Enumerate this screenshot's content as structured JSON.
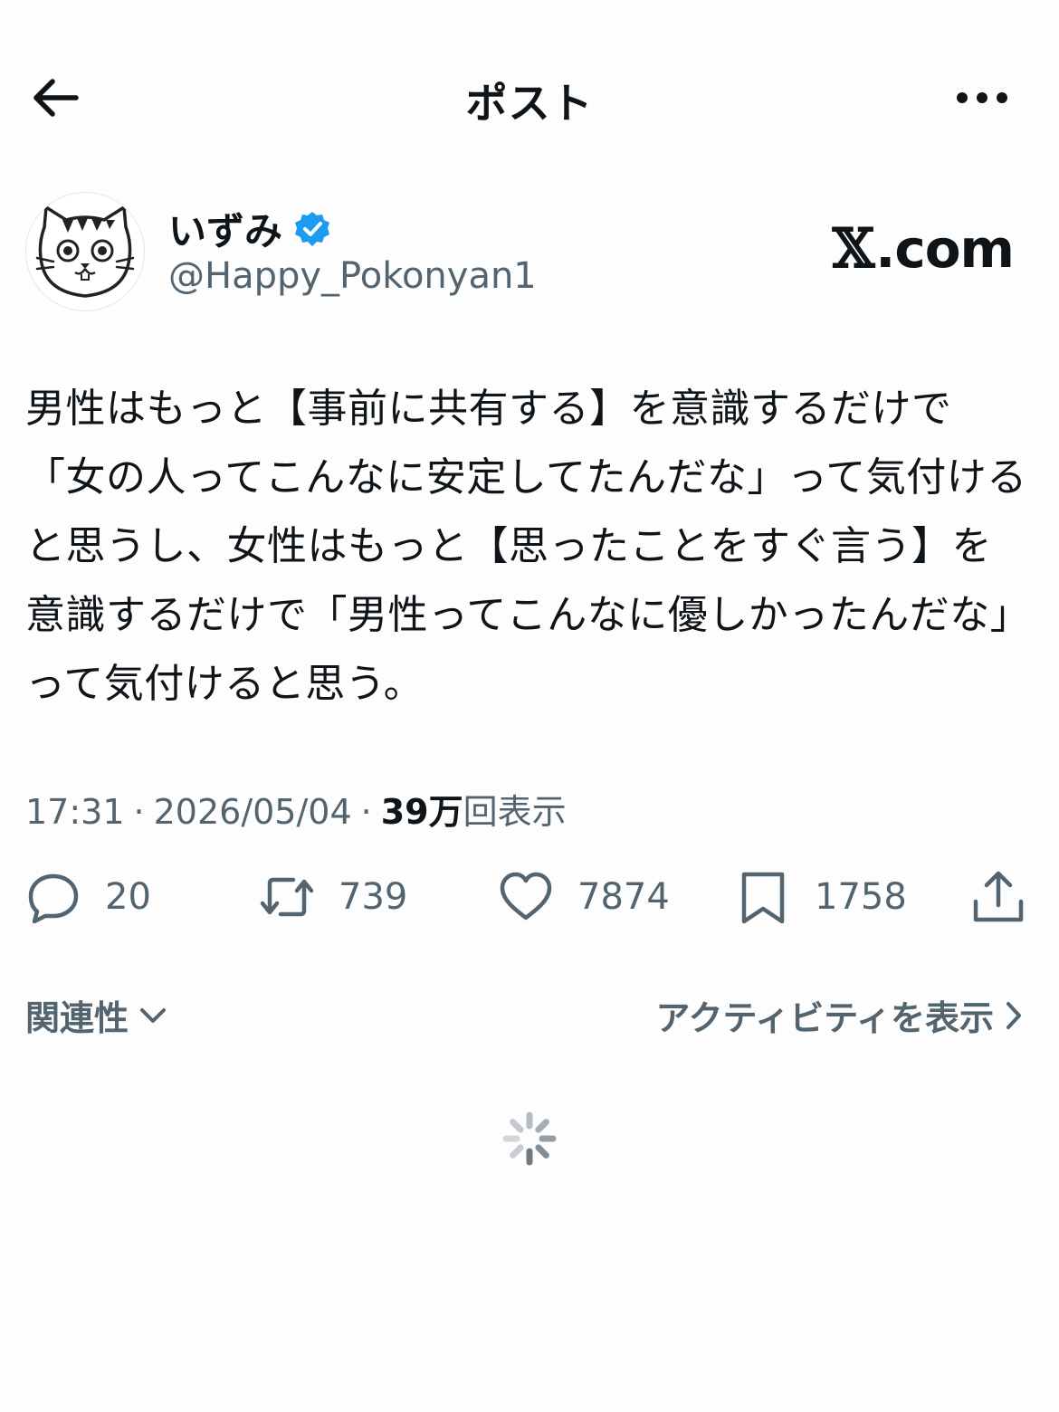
{
  "header": {
    "title": "ポスト",
    "back_icon": "arrow-left-icon",
    "more_icon": "more-horizontal-icon"
  },
  "author": {
    "display_name": "いずみ",
    "handle": "@Happy_Pokonyan1",
    "verified": true,
    "verified_color": "#1d9bf0"
  },
  "watermark": {
    "x": "𝕏",
    "domain": ".com"
  },
  "post": {
    "text": "男性はもっと【事前に共有する】を意識するだけで「女の人ってこんなに安定してたんだな」って気付けると思うし、女性はもっと【思ったことをすぐ言う】を意識するだけで「男性ってこんなに優しかったんだな」って気付けると思う。",
    "time": "17:31",
    "separator": "·",
    "date": "2026/05/04",
    "views_count": "39万",
    "views_label": "回表示"
  },
  "actions": {
    "replies": "20",
    "reposts": "739",
    "likes": "7874",
    "bookmarks": "1758"
  },
  "footer": {
    "sort_label": "関連性",
    "activity_label": "アクティビティを表示"
  },
  "colors": {
    "text": "#0f1419",
    "secondary": "#536471",
    "accent": "#1d9bf0"
  }
}
